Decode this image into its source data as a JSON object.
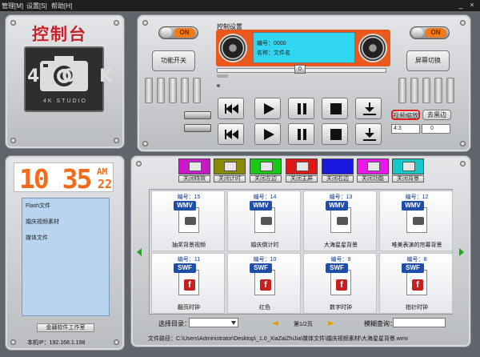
{
  "menu": {
    "manage": "管理[M]",
    "settings": "设置[S]",
    "help": "帮助[H]",
    "minimize": "_",
    "close": "×"
  },
  "left": {
    "title": "控制台",
    "logo_text": "4OK",
    "logo_sub": "4K STUDIO"
  },
  "control": {
    "label": "控制设置",
    "on_left": "ON",
    "on_right": "ON",
    "power_button": "功能开关",
    "screen_switch": "屏幕切换",
    "display_number": "编号：0000",
    "display_name": "名称：文件名",
    "progress_value": "0",
    "video_scale": "视频缩放",
    "black_border": "去黑边",
    "ratio_select": "4:3",
    "ratio_offset": "0"
  },
  "clock": {
    "time": "10 35",
    "ampm": "AM",
    "seconds": "22"
  },
  "list": {
    "items": [
      "Flash文件",
      "婚庆视频素材",
      "媒体文件"
    ],
    "footer": "金疆软件工作室",
    "ip": "本机IP：192.168.1.198"
  },
  "chips": [
    {
      "label": "关闭特效",
      "color": "#c818c8"
    },
    {
      "label": "关闭计时",
      "color": "#8a8a00"
    },
    {
      "label": "关闭左边",
      "color": "#17c817"
    },
    {
      "label": "关闭主屏",
      "color": "#e01818"
    },
    {
      "label": "关闭右边",
      "color": "#1818e0"
    },
    {
      "label": "关闭功能",
      "color": "#ee16ee"
    },
    {
      "label": "关闭背景",
      "color": "#18c8c8"
    }
  ],
  "tiles": [
    {
      "num": "编号：15",
      "type": "WMV",
      "name": "抽奖背景视频"
    },
    {
      "num": "编号：14",
      "type": "WMV",
      "name": "婚庆倒计时"
    },
    {
      "num": "编号：13",
      "type": "WMV",
      "name": "大海星星背景"
    },
    {
      "num": "编号：12",
      "type": "WMV",
      "name": "唯美表演的帘幕背景"
    },
    {
      "num": "编号：11",
      "type": "SWF",
      "name": "翻页时钟"
    },
    {
      "num": "编号：10",
      "type": "SWF",
      "name": "红色"
    },
    {
      "num": "编号：9",
      "type": "SWF",
      "name": "数字时钟"
    },
    {
      "num": "编号：8",
      "type": "SWF",
      "name": "指针时钟"
    }
  ],
  "bottom": {
    "select_dir": "选择目录：",
    "page": "第1/2页",
    "fuzzy": "模糊查询：",
    "path": "文件路径：C:\\Users\\Administrator\\Desktop\\_1.0_XiaZaiZhiJia\\媒体文件\\婚庆视频素材\\大海星星背景.wmv"
  },
  "colors": {
    "display_bg": "#31d6f0",
    "display_frame": "#e9581c",
    "clock_digits": "#f56a1a",
    "list_bg": "#b8d4f0"
  }
}
